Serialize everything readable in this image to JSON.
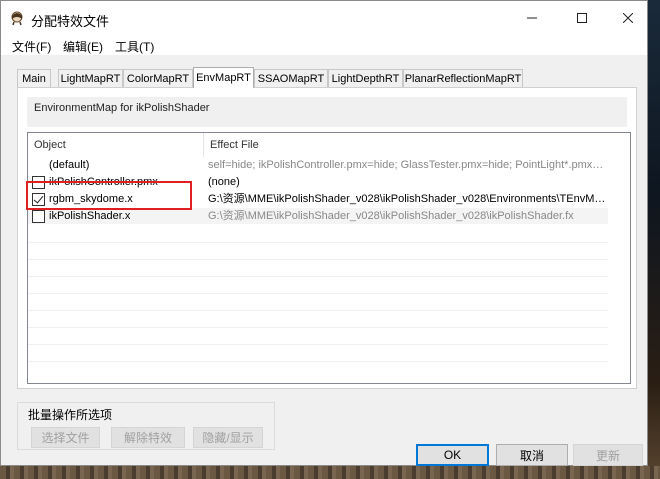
{
  "window": {
    "title": "分配特效文件"
  },
  "menu": {
    "items": [
      "文件(F)",
      "编辑(E)",
      "工具(T)"
    ]
  },
  "tabs": [
    "Main",
    "LightMapRT",
    "ColorMapRT",
    "EnvMapRT",
    "SSAOMapRT",
    "LightDepthRT",
    "PlanarReflectionMapRT"
  ],
  "active_tab": "EnvMapRT",
  "panel": {
    "description": "EnvironmentMap for ikPolishShader"
  },
  "list": {
    "columns": [
      "Object",
      "Effect File"
    ],
    "rows": [
      {
        "name": "(default)",
        "effect": "self=hide; ikPolishController.pmx=hide; GlassTester.pmx=hide; PointLight*.pmx=hide;",
        "checkbox": false,
        "checked": false,
        "effect_grey": true
      },
      {
        "name": "ikPolishController.pmx",
        "effect": "(none)",
        "checkbox": true,
        "checked": false,
        "effect_grey": false
      },
      {
        "name": "rgbm_skydome.x",
        "effect": "G:\\资源\\MME\\ikPolishShader_v028\\ikPolishShader_v028\\Environments\\TEnvMap.fx",
        "checkbox": true,
        "checked": true,
        "effect_grey": false
      },
      {
        "name": "ikPolishShader.x",
        "effect": "G:\\资源\\MME\\ikPolishShader_v028\\ikPolishShader_v028\\ikPolishShader.fx",
        "checkbox": true,
        "checked": false,
        "effect_grey": true
      }
    ]
  },
  "batch": {
    "label": "批量操作所选项",
    "select_file": "选择文件",
    "release_effect": "解除特效",
    "hide_show": "隐藏/显示"
  },
  "dialog": {
    "ok": "OK",
    "cancel": "取消",
    "update": "更新"
  }
}
